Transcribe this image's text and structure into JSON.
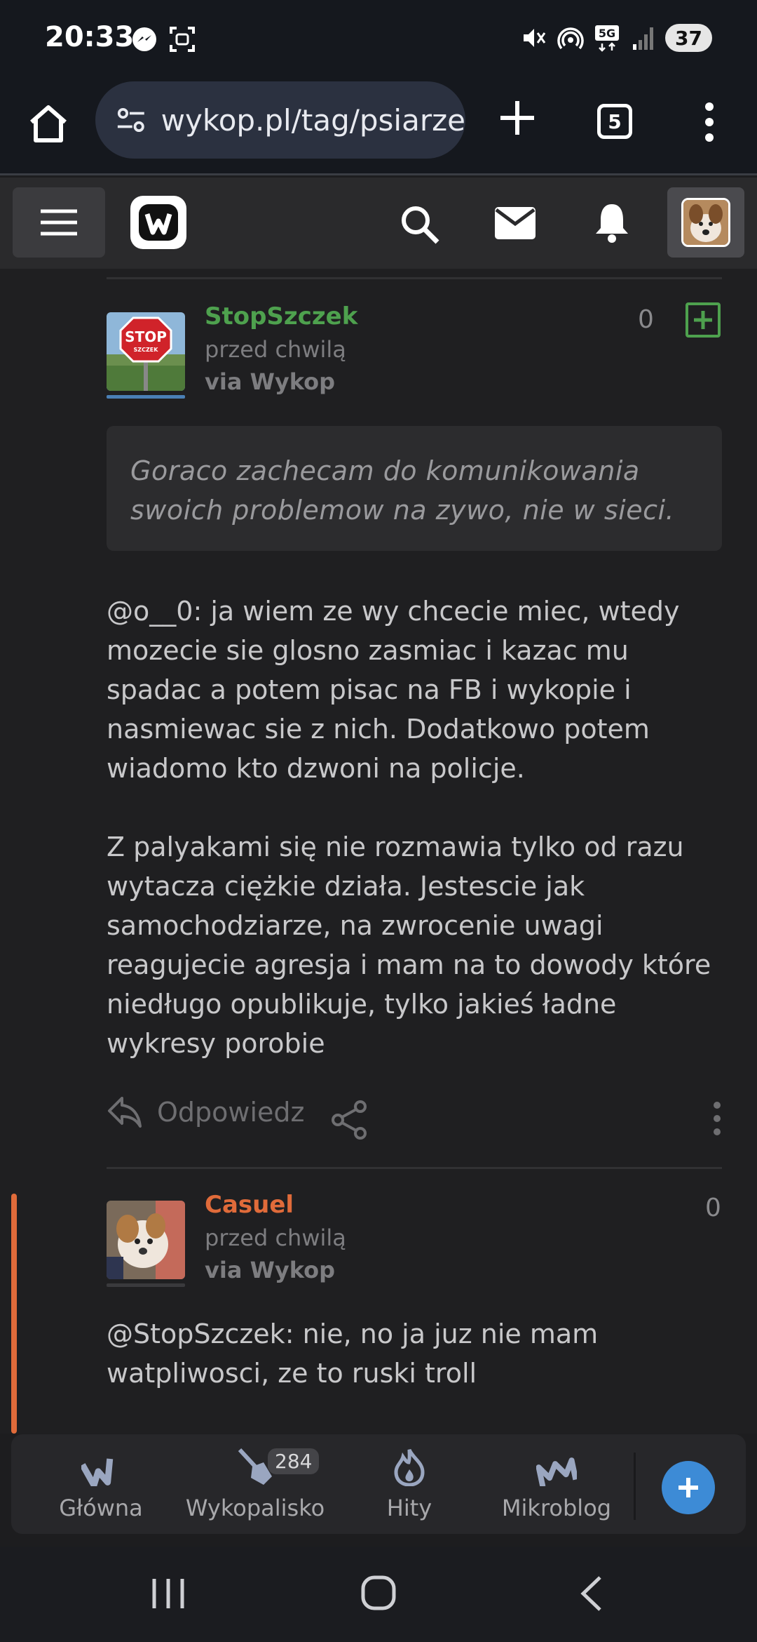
{
  "status_bar": {
    "time": "20:33",
    "battery": "37",
    "network": "5G"
  },
  "browser": {
    "url": "wykop.pl/tag/psiarze",
    "tab_count": "5"
  },
  "posts": [
    {
      "author": "StopSzczek",
      "author_color": "#4ea14e",
      "time": "przed chwilą",
      "via": "via Wykop",
      "votes": "0",
      "avatar_text": "STOP",
      "avatar_subtext": "SZCZEK",
      "quote": "Goraco zachecam do komunikowania swoich problemow na zywo, nie w sieci.",
      "mention": "@o__0",
      "paragraph1": ": ja wiem ze wy chcecie miec, wtedy mozecie sie glosno zasmiac i kazac mu spadac a potem pisac na FB i wykopie i nasmiewac sie z nich. Dodatkowo potem wiadomo kto dzwoni na policje.",
      "paragraph2": "Z palyakami się nie rozmawia tylko od razu wytacza ciężkie działa. Jestescie jak samochodziarze, na zwrocenie uwagi reagujecie agresja i mam na to dowody które niedługo opublikuje, tylko jakieś ładne wykresy porobie",
      "reply_label": "Odpowiedz"
    },
    {
      "author": "Casuel",
      "author_color": "#e06b3a",
      "time": "przed chwilą",
      "via": "via Wykop",
      "votes": "0",
      "mention": "@StopSzczek",
      "text": ": nie, no ja juz nie mam watpliwosci, ze to ruski troll"
    }
  ],
  "bottom_nav": {
    "items": [
      {
        "label": "Główna",
        "icon": "wykop-home-icon"
      },
      {
        "label": "Wykopalisko",
        "icon": "shovel-icon",
        "badge": "284"
      },
      {
        "label": "Hity",
        "icon": "flame-icon"
      },
      {
        "label": "Mikroblog",
        "icon": "mikroblog-icon"
      }
    ],
    "fab_icon": "plus-icon"
  },
  "colors": {
    "accent_blue": "#3d8bd6",
    "plus_green": "#4ea14e",
    "casuel_orange": "#e06b3a"
  }
}
